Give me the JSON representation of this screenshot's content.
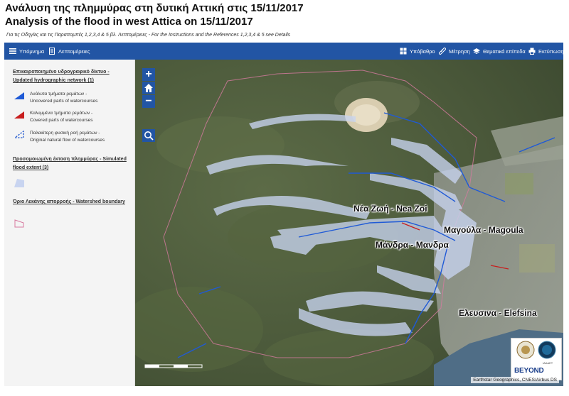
{
  "header": {
    "title_gr": "Ανάλυση της πλημμύρας στη δυτική Αττική στις 15/11/2017",
    "title_en": "Analysis of the flood in west Attica on 15/11/2017",
    "subtitle": "Για τις Οδηγίες και τις Παραπομπές 1,2,3,4 & 5 βλ. Λεπτομέρειες - For the Instructions and the References 1,2,3,4 & 5 see Details"
  },
  "toolbar": {
    "legend_label": "Υπόμνημα",
    "details_label": "Λεπτομέρειες",
    "basemap_label": "Υπόβαθρο",
    "measure_label": "Μέτρηση",
    "layers_label": "Θεματικά επίπεδα",
    "print_label": "Εκτύπωση"
  },
  "legend": {
    "section1_title": "Επικαιροποιημένο υδρογραφικό δίκτυο - Updated hydrographic network (1)",
    "item1_gr": "Ανάλυτα τμήματα ρεμάτων -",
    "item1_en": "Uncovered parts of watercourses",
    "item2_gr": "Καλυμμένα τμήματα ρεμάτων -",
    "item2_en": "Covered parts of watercourses",
    "item3_gr": "Παλαιότερη φυσική ροή ρεμάτων -",
    "item3_en": "Original natural flow of watercourses",
    "section2_title": "Προσομοιωμένη έκταση πλημμύρας - Simulated flood extent (3)",
    "section3_title": "Όριο Λεκάνης απορροής - Watershed boundary",
    "colors": {
      "uncovered": "#1f5ad6",
      "covered": "#c81e1e",
      "original": "#2b5fd0",
      "flood": "#c8d4f0",
      "watershed": "#d77aa0"
    }
  },
  "map": {
    "places": {
      "nea_zoi": "Νέα Ζωή - Nea Zoi",
      "magoula": "Μαγούλα - Magoula",
      "mandra": "Μάνδρα - Μανδρα",
      "elefsina": "Ελευσινα - Elefsina"
    },
    "attribution": "Earthstar Geographics, CNES/Airbus DS",
    "logo_text": "BEYOND",
    "logo_sub": "ΙΑΑΔΕΤ"
  }
}
